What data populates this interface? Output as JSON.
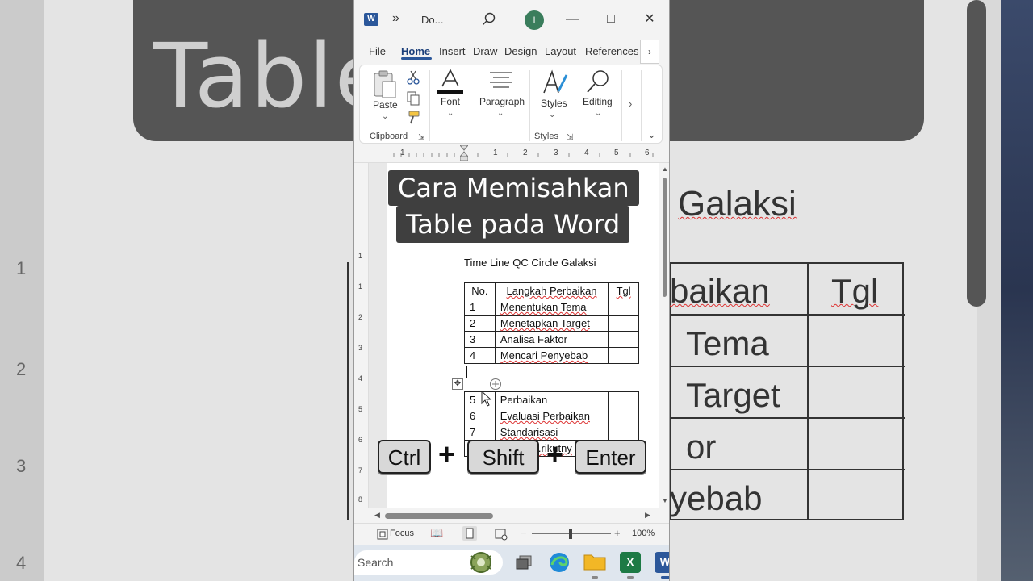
{
  "window": {
    "doc_title": "Do...",
    "avatar_initial": "I"
  },
  "tabs": [
    "File",
    "Home",
    "Insert",
    "Draw",
    "Design",
    "Layout",
    "References"
  ],
  "ribbon": {
    "paste": "Paste",
    "clipboard": "Clipboard",
    "font": "Font",
    "paragraph": "Paragraph",
    "styles": "Styles",
    "editing": "Editing",
    "styles_group": "Styles"
  },
  "ruler_numbers": [
    "1",
    "1",
    "2",
    "3",
    "4",
    "5",
    "6"
  ],
  "vruler_numbers": [
    "1",
    "1",
    "2",
    "3",
    "4",
    "5",
    "6",
    "7",
    "8"
  ],
  "overlay": {
    "line1": "Cara Memisahkan",
    "line2": "Table pada Word"
  },
  "document": {
    "heading": "Time Line QC Circle Galaksi",
    "table1": {
      "header": [
        "No.",
        "Langkah Perbaikan",
        "Tgl"
      ],
      "rows": [
        [
          "1",
          "Menentukan Tema",
          ""
        ],
        [
          "2",
          "Menetapkan Target",
          ""
        ],
        [
          "3",
          "Analisa Faktor",
          ""
        ],
        [
          "4",
          "Mencari Penyebab",
          ""
        ]
      ]
    },
    "table2": {
      "rows": [
        [
          "5",
          "Perbaikan",
          ""
        ],
        [
          "6",
          "Evaluasi Perbaikan",
          ""
        ],
        [
          "7",
          "Standarisasi",
          ""
        ],
        [
          "",
          "...rikutny",
          ""
        ]
      ]
    }
  },
  "keys": [
    "Ctrl",
    "+",
    "Shift",
    "+",
    "Enter"
  ],
  "status": {
    "focus": "Focus",
    "zoom": "100%"
  },
  "taskbar": {
    "search_placeholder": "Search"
  },
  "background": {
    "banner": "Table        Word",
    "galaksi": "Galaksi",
    "cells": [
      "baikan",
      "Tgl",
      "Tema",
      "Target",
      "or",
      "yebab"
    ],
    "ruler": [
      "1",
      "2",
      "3",
      "4"
    ]
  }
}
